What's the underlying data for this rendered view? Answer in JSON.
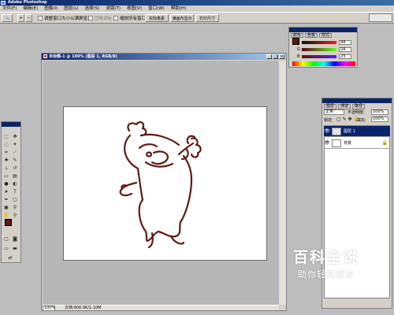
{
  "app": {
    "title": "Adobe Photoshop"
  },
  "menubar": {
    "items": [
      "文件(F)",
      "编辑(E)",
      "图像(I)",
      "图层(L)",
      "选择(S)",
      "滤镜(T)",
      "视图(V)",
      "窗口(W)",
      "帮助(H)"
    ]
  },
  "options_bar": {
    "resize_windows_label": "调整窗口大小以满屏显示",
    "ignore_palettes_label": "忽略调板",
    "zoom_all_windows_label": "缩放所有窗口",
    "actual_pixels_label": "实际像素",
    "fit_on_screen_label": "满画布显示",
    "print_size_label": "打印尺寸"
  },
  "document": {
    "title": "未标题-1 @ 100% (图层 1, RGB/8)",
    "zoom": "100%",
    "info": "文档:900.0K/1.10M"
  },
  "color_panel": {
    "tabs": [
      "颜色",
      "色板",
      "样式"
    ],
    "channels": [
      {
        "label": "R",
        "value": "94"
      },
      {
        "label": "G",
        "value": "24"
      },
      {
        "label": "B",
        "value": "23"
      }
    ],
    "foreground_color": "#5c1a14"
  },
  "layers_panel": {
    "tabs": [
      "图层",
      "通道",
      "路径"
    ],
    "blend_mode": "正常",
    "opacity_label": "不透明度:",
    "opacity": "100%",
    "lock_label": "锁定:",
    "fill_label": "填充:",
    "fill": "100%",
    "layers": [
      {
        "name": "图层 1",
        "selected": true
      },
      {
        "name": "背景",
        "selected": false
      }
    ]
  },
  "toolbox": {
    "foreground_color": "#5c1a14",
    "background_color": "#ffffff"
  },
  "watermark": {
    "main": "百科全说",
    "sub": "助你轻松解决"
  }
}
